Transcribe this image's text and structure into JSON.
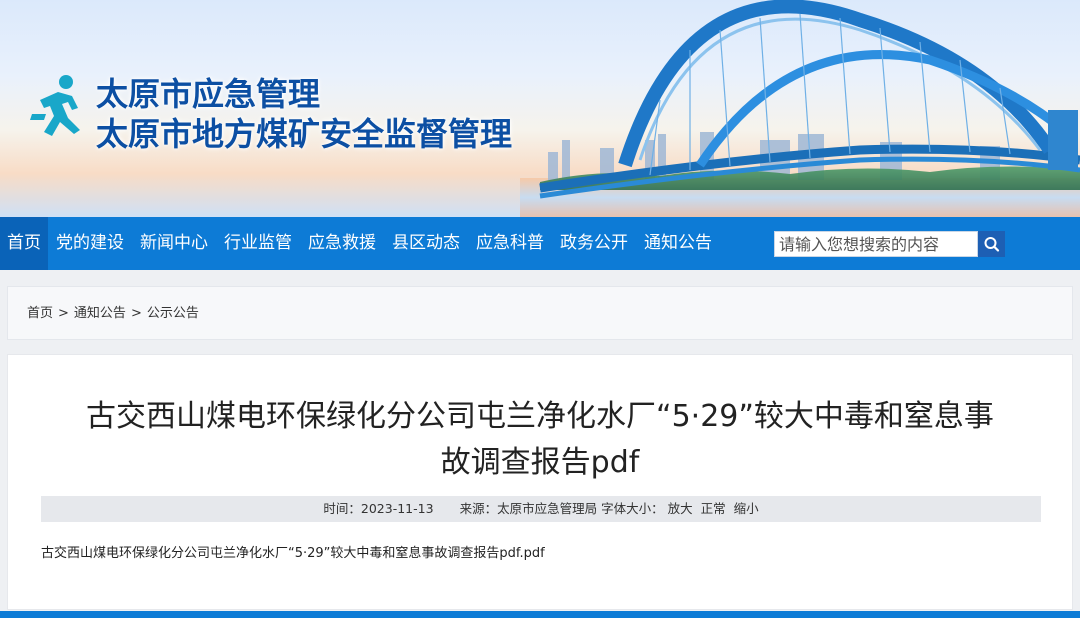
{
  "header": {
    "title_line1": "太原市应急管理",
    "title_line2": "太原市地方煤矿安全监督管理",
    "logo_icon": "running-person-icon",
    "colors": {
      "title": "#0c4fa3",
      "nav": "#0d7bd6",
      "nav_active": "#0a63b8",
      "search_button": "#1d5fb4"
    }
  },
  "nav": {
    "items": [
      "首页",
      "党的建设",
      "新闻中心",
      "行业监管",
      "应急救援",
      "县区动态",
      "应急科普",
      "政务公开",
      "通知公告"
    ],
    "active": "首页"
  },
  "search": {
    "placeholder": "请输入您想搜索的内容",
    "button_icon": "search-icon"
  },
  "breadcrumb": {
    "items": [
      "首页",
      "通知公告",
      "公示公告"
    ],
    "separator": ">"
  },
  "article": {
    "title_line1": "古交西山煤电环保绿化分公司屯兰净化水厂“5·29”较大中毒和窒息事",
    "title_line2": "故调查报告pdf",
    "meta": {
      "date_label": "时间：",
      "date": "2023-11-13",
      "source_label": "来源：",
      "source": "太原市应急管理局",
      "font_size_label": "字体大小：",
      "font_large": "放大",
      "font_normal": "正常",
      "font_small": "缩小"
    },
    "attachment": "古交西山煤电环保绿化分公司屯兰净化水厂“5·29”较大中毒和窒息事故调查报告pdf.pdf"
  }
}
